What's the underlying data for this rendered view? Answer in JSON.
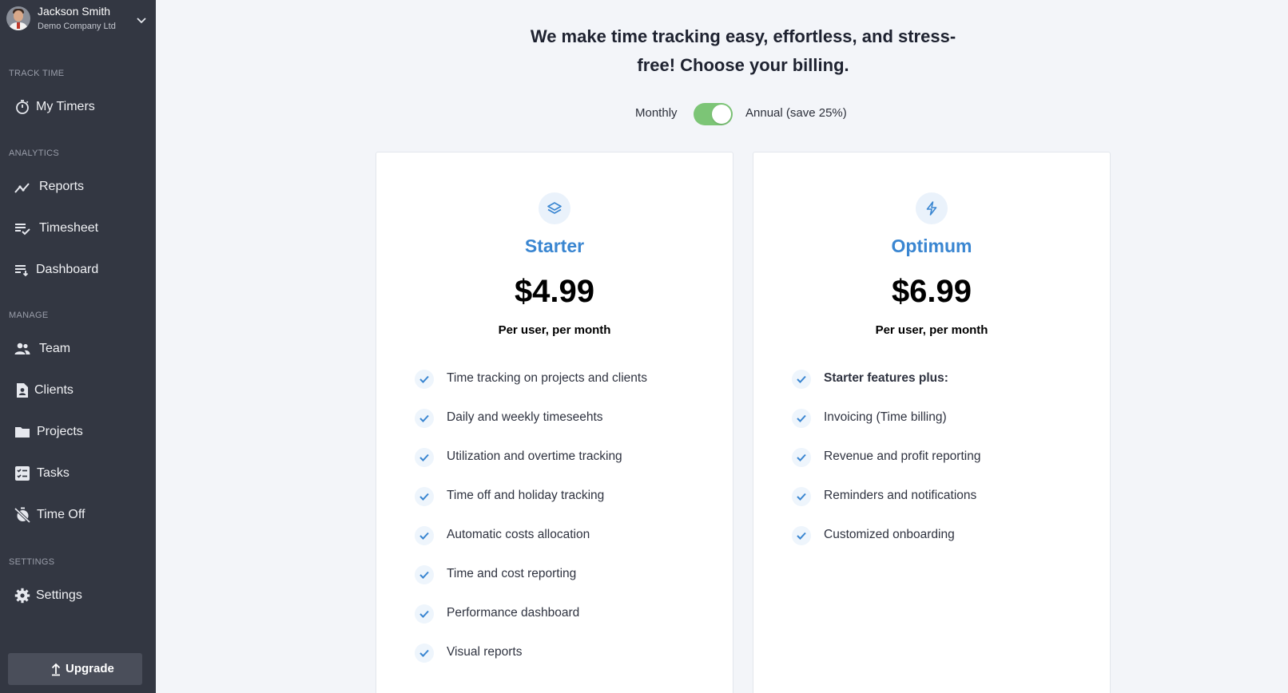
{
  "user": {
    "name": "Jackson Smith",
    "company": "Demo Company Ltd"
  },
  "sidebar": {
    "sections": [
      {
        "label": "TRACK TIME",
        "items": [
          {
            "label": "My Timers",
            "icon": "stopwatch-icon"
          }
        ]
      },
      {
        "label": "ANALYTICS",
        "items": [
          {
            "label": "Reports",
            "icon": "trend-chart-icon"
          },
          {
            "label": "Timesheet",
            "icon": "list-check-icon"
          },
          {
            "label": "Dashboard",
            "icon": "list-sort-icon"
          }
        ]
      },
      {
        "label": "MANAGE",
        "items": [
          {
            "label": "Team",
            "icon": "team-icon"
          },
          {
            "label": "Clients",
            "icon": "client-badge-icon"
          },
          {
            "label": "Projects",
            "icon": "folder-icon"
          },
          {
            "label": "Tasks",
            "icon": "task-list-icon"
          },
          {
            "label": "Time Off",
            "icon": "timer-off-icon"
          }
        ]
      },
      {
        "label": "SETTINGS",
        "items": [
          {
            "label": "Settings",
            "icon": "gear-icon"
          }
        ]
      }
    ],
    "upgrade_label": "Upgrade"
  },
  "headline": {
    "line1": "We make time tracking easy, effortless, and stress-",
    "line2": "free! Choose your billing."
  },
  "billing": {
    "monthly_label": "Monthly",
    "annual_label": "Annual (save 25%)",
    "annual_selected": true,
    "toggle_color": "#7cc576"
  },
  "accent_color": "#3a86d1",
  "plans": [
    {
      "name": "Starter",
      "icon": "layers-icon",
      "price": "$4.99",
      "period": "Per user, per month",
      "features": [
        "Time tracking on projects and clients",
        "Daily and weekly timeseehts",
        "Utilization and overtime tracking",
        "Time off and holiday tracking",
        "Automatic costs allocation",
        "Time and cost reporting",
        "Performance dashboard",
        "Visual reports"
      ]
    },
    {
      "name": "Optimum",
      "icon": "lightning-icon",
      "price": "$6.99",
      "period": "Per user, per month",
      "features_heading": "Starter features plus:",
      "features": [
        "Invoicing (Time billing)",
        "Revenue and profit reporting",
        "Reminders and notifications",
        "Customized onboarding"
      ]
    }
  ]
}
